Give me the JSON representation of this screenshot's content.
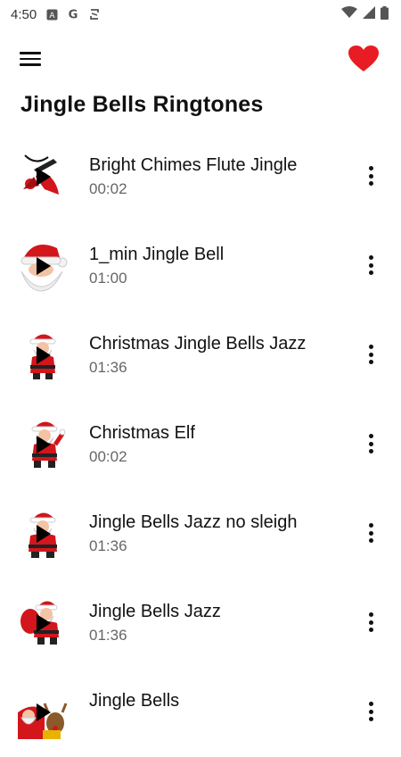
{
  "status_bar": {
    "time": "4:50",
    "icons": [
      "sim-a-icon",
      "google-icon",
      "sync-icon",
      "wifi-icon",
      "signal-icon",
      "battery-icon"
    ]
  },
  "header": {
    "title": "Jingle Bells Ringtones",
    "menu_icon": "hamburger-menu-icon",
    "favorite_icon": "heart-icon",
    "favorite_color": "#e81c23"
  },
  "ringtones": [
    {
      "title": "Bright Chimes Flute Jingle",
      "duration": "00:02",
      "thumb": "bells-thumbnail"
    },
    {
      "title": "1_min Jingle Bell",
      "duration": "01:00",
      "thumb": "santa-face-thumbnail"
    },
    {
      "title": "Christmas Jingle Bells Jazz",
      "duration": "01:36",
      "thumb": "santa-thumbnail"
    },
    {
      "title": "Christmas Elf",
      "duration": "00:02",
      "thumb": "santa-waving-thumbnail"
    },
    {
      "title": "Jingle Bells Jazz no sleigh",
      "duration": "01:36",
      "thumb": "santa-thumbnail"
    },
    {
      "title": "Jingle Bells Jazz",
      "duration": "01:36",
      "thumb": "santa-sack-thumbnail"
    },
    {
      "title": "Jingle Bells",
      "duration": "",
      "thumb": "santa-reindeer-thumbnail"
    }
  ]
}
